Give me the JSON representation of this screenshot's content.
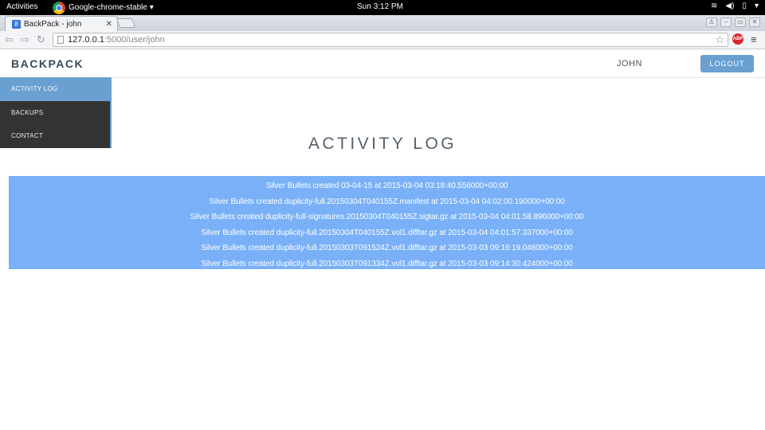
{
  "os_bar": {
    "activities": "Activities",
    "app_name": "Google-chrome-stable ▾",
    "clock": "Sun  3:12 PM"
  },
  "browser": {
    "tab_title": "BackPack - john",
    "url_host": "127.0.0.1",
    "url_rest": ":5000/user/john"
  },
  "app": {
    "brand": "BACKPACK",
    "user": "JOHN",
    "logout_label": "LOGOUT",
    "sidebar": [
      {
        "label": "ACTIVITY LOG",
        "active": true
      },
      {
        "label": "BACKUPS",
        "active": false
      },
      {
        "label": "CONTACT",
        "active": false
      }
    ],
    "page_title": "ACTIVITY LOG",
    "log_entries": [
      "Silver Bullets created 03-04-15 at 2015-03-04 03:18:40.556000+00:00",
      "Silver Bullets created duplicity-full.20150304T040155Z.manifest at 2015-03-04 04:02:00.190000+00:00",
      "Silver Bullets created duplicity-full-signatures.20150304T040155Z.sigtar.gz at 2015-03-04 04:01:58.896000+00:00",
      "Silver Bullets created duplicity-full.20150304T040155Z.vol1.difftar.gz at 2015-03-04 04:01:57.337000+00:00",
      "Silver Bullets created duplicity-full.20150303T091524Z.vol1.difftar.gz at 2015-03-03 09:16:19.048000+00:00",
      "Silver Bullets created duplicity-full.20150303T091334Z.vol1.difftar.gz at 2015-03-03 09:14:30.424000+00:00"
    ]
  },
  "colors": {
    "accent": "#6a9fd1",
    "log_panel": "#79b0f7",
    "sidebar_bg": "#333333"
  }
}
